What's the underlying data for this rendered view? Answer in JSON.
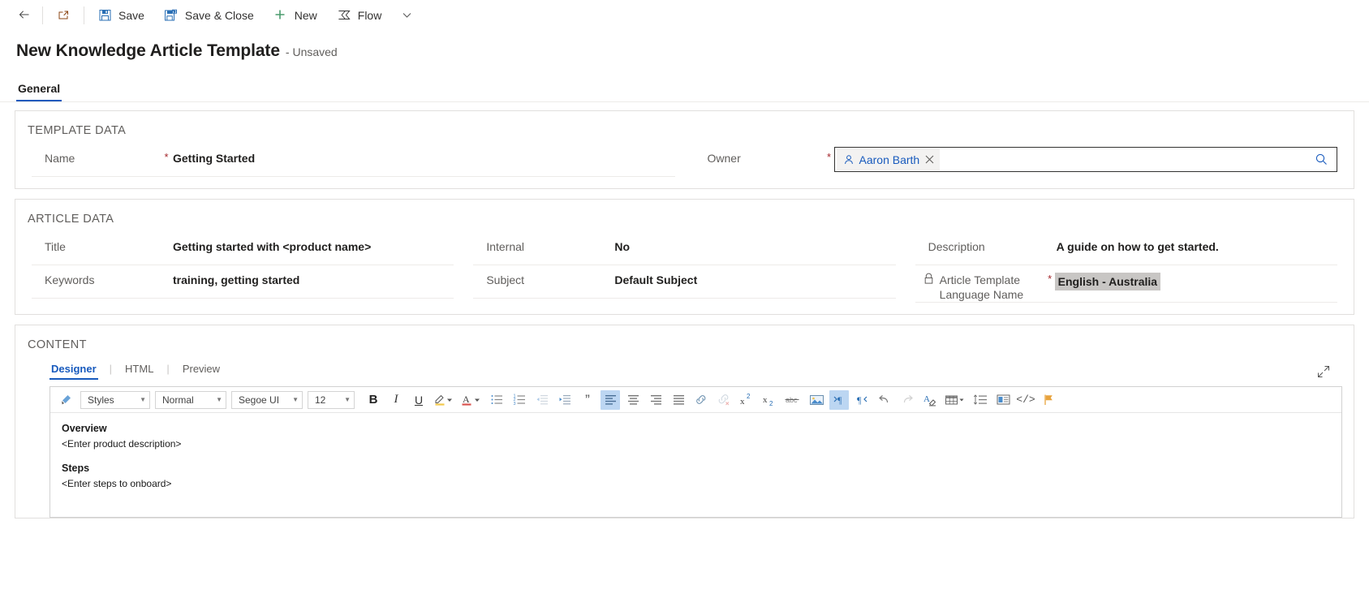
{
  "commandbar": {
    "back_label": "",
    "popout_label": "",
    "items": [
      {
        "id": "save",
        "label": "Save",
        "icon": "save-icon"
      },
      {
        "id": "save-close",
        "label": "Save & Close",
        "icon": "save-close-icon"
      },
      {
        "id": "new",
        "label": "New",
        "icon": "plus-icon"
      },
      {
        "id": "flow",
        "label": "Flow",
        "icon": "flow-icon"
      }
    ],
    "overflow_label": ""
  },
  "header": {
    "title": "New Knowledge Article Template",
    "subtitle": "- Unsaved"
  },
  "tabs": [
    {
      "label": "General",
      "active": true
    }
  ],
  "template_data": {
    "section_title": "TEMPLATE DATA",
    "name": {
      "label": "Name",
      "required": "*",
      "value": "Getting Started"
    },
    "owner": {
      "label": "Owner",
      "required": "*",
      "pill_name": "Aaron Barth",
      "clear_label": "",
      "search_label": ""
    }
  },
  "article_data": {
    "section_title": "ARTICLE DATA",
    "title": {
      "label": "Title",
      "value": "Getting started with <product name>"
    },
    "keywords": {
      "label": "Keywords",
      "value": "training, getting started"
    },
    "internal": {
      "label": "Internal",
      "value": "No"
    },
    "subject": {
      "label": "Subject",
      "value": "Default Subject"
    },
    "description": {
      "label": "Description",
      "value": "A guide on how to get started."
    },
    "language": {
      "label_line1": "Article Template",
      "label_line2": "Language Name",
      "required": "*",
      "value": "English - Australia"
    }
  },
  "content": {
    "section_title": "CONTENT",
    "editor_tabs": [
      {
        "label": "Designer",
        "active": true
      },
      {
        "label": "HTML",
        "active": false
      },
      {
        "label": "Preview",
        "active": false
      }
    ],
    "tab_separator": "|",
    "expand_label": "",
    "toolbar": {
      "format_painter": "format-painter-icon",
      "styles": "Styles",
      "paragraph_format": "Normal",
      "font_family": "Segoe UI",
      "font_size": "12",
      "bold": "B",
      "italic": "I",
      "underline": "U",
      "buttons": [
        {
          "id": "text-highlight",
          "name": "text-highlight-color-icon"
        },
        {
          "id": "text-color",
          "name": "text-color-icon"
        },
        {
          "id": "bulleted-list",
          "name": "bulleted-list-icon"
        },
        {
          "id": "numbered-list",
          "name": "numbered-list-icon"
        },
        {
          "id": "decrease-indent",
          "name": "decrease-indent-icon"
        },
        {
          "id": "increase-indent",
          "name": "increase-indent-icon"
        },
        {
          "id": "block-quote",
          "name": "block-quote-icon"
        },
        {
          "id": "align-left",
          "name": "align-left-icon"
        },
        {
          "id": "align-center",
          "name": "align-center-icon"
        },
        {
          "id": "align-right",
          "name": "align-right-icon"
        },
        {
          "id": "justify",
          "name": "align-justify-icon"
        },
        {
          "id": "link",
          "name": "insert-link-icon"
        },
        {
          "id": "unlink",
          "name": "remove-link-icon"
        },
        {
          "id": "superscript",
          "name": "superscript-icon"
        },
        {
          "id": "subscript",
          "name": "subscript-icon"
        },
        {
          "id": "strikethrough",
          "name": "strikethrough-icon"
        },
        {
          "id": "image",
          "name": "insert-image-icon"
        },
        {
          "id": "ltr",
          "name": "left-to-right-icon"
        },
        {
          "id": "rtl",
          "name": "right-to-left-icon"
        },
        {
          "id": "undo",
          "name": "undo-icon"
        },
        {
          "id": "redo",
          "name": "redo-icon"
        },
        {
          "id": "clear-format",
          "name": "clear-formatting-icon"
        },
        {
          "id": "table",
          "name": "insert-table-icon"
        },
        {
          "id": "line-spacing",
          "name": "line-spacing-icon"
        },
        {
          "id": "page-break",
          "name": "page-break-icon"
        },
        {
          "id": "source-code",
          "name": "source-code-icon"
        },
        {
          "id": "flag",
          "name": "flag-icon"
        }
      ]
    },
    "body": {
      "overview_heading": "Overview",
      "overview_text": "<Enter product description>",
      "steps_heading": "Steps",
      "steps_text": "<Enter steps to onboard>"
    }
  },
  "colors": {
    "accent": "#185abd",
    "required": "#a4262c",
    "label": "#605e5c",
    "border": "#e1dfdd",
    "highlight": "#c8c6c4",
    "toolbar_active": "#bcd6f2",
    "new_icon_green": "#4a9b6e"
  }
}
